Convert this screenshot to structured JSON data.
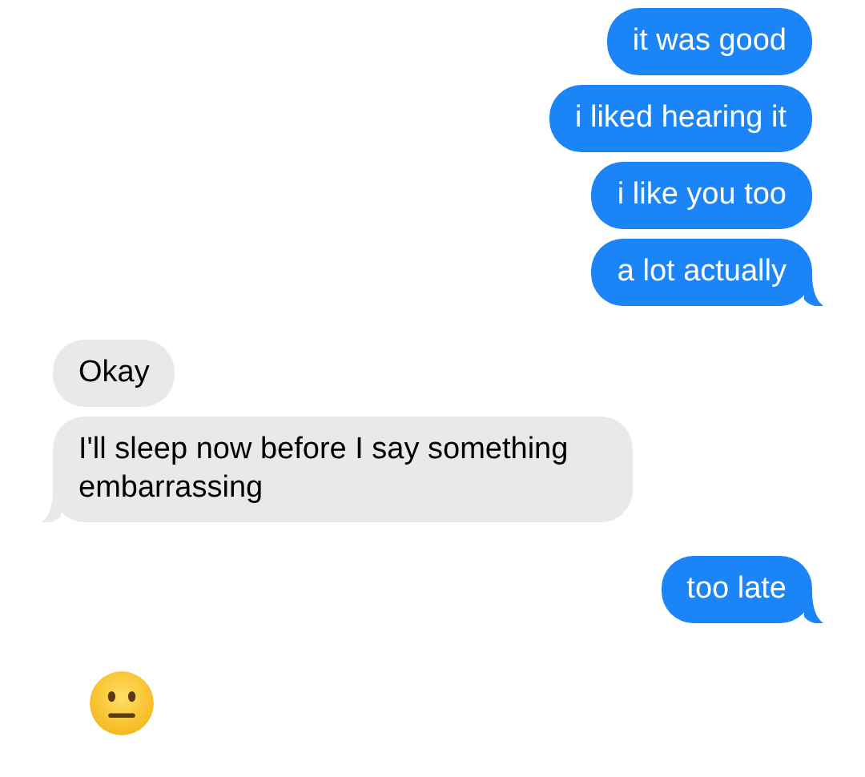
{
  "groups": [
    {
      "outgoing": true,
      "messages": [
        {
          "kind": "text",
          "text": "it was good"
        },
        {
          "kind": "text",
          "text": "i liked hearing it"
        },
        {
          "kind": "text",
          "text": "i like you too"
        },
        {
          "kind": "text",
          "text": "a lot actually"
        }
      ]
    },
    {
      "outgoing": false,
      "messages": [
        {
          "kind": "text",
          "text": "Okay"
        },
        {
          "kind": "text",
          "text": "I'll sleep now before I say something embarrassing"
        }
      ]
    },
    {
      "outgoing": true,
      "messages": [
        {
          "kind": "text",
          "text": "too late"
        }
      ]
    },
    {
      "messages": [
        {
          "kind": "emoji"
        }
      ]
    }
  ]
}
